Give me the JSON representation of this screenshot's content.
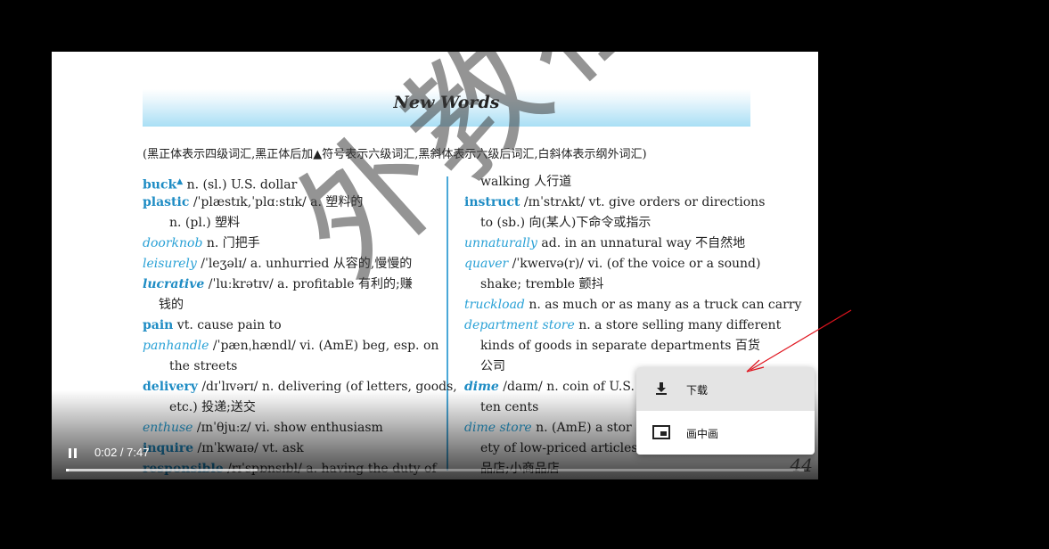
{
  "page": {
    "banner_title": "New Words",
    "note": "(黑正体表示四级词汇,黑正体后加▲符号表示六级词汇,黑斜体表示六级后词汇,白斜体表示纲外词汇)",
    "watermark": "外教社",
    "page_number": "44",
    "left_column": [
      {
        "hw": "buck",
        "mark": "▲",
        "style": "bold",
        "rest": " n. (sl.) U.S. dollar"
      },
      {
        "hw": "plastic",
        "style": "bold",
        "rest": " /ˈplæstɪk,ˈplɑːstɪk/ a. 塑料的"
      },
      {
        "hw": "",
        "style": "indent",
        "rest": "n. (pl.) 塑料"
      },
      {
        "hw": "doorknob",
        "style": "italic",
        "rest": " n. 门把手"
      },
      {
        "hw": "leisurely",
        "style": "italic",
        "rest": " /ˈleʒəlɪ/ a. unhurried  从容的,慢慢的"
      },
      {
        "hw": "lucrative",
        "style": "bolditalic",
        "rest": " /ˈluːkrətɪv/ a. profitable  有利的;赚"
      },
      {
        "hw": "",
        "style": "indent-small",
        "rest": "钱的"
      },
      {
        "hw": "pain",
        "style": "bold",
        "rest": " vt. cause pain to"
      },
      {
        "hw": "panhandle",
        "style": "italic",
        "rest": " /ˈpænˌhændl/ vi. (AmE) beg, esp. on"
      },
      {
        "hw": "",
        "style": "indent",
        "rest": "the streets"
      },
      {
        "hw": "delivery",
        "style": "bold",
        "rest": " /dɪˈlɪvərɪ/ n. delivering (of letters, goods,"
      },
      {
        "hw": "",
        "style": "indent",
        "rest": "etc.)  投递;送交"
      },
      {
        "hw": "enthuse",
        "style": "italic",
        "rest": " /ɪnˈθjuːz/ vi. show enthusiasm"
      },
      {
        "hw": "inquire",
        "style": "bold",
        "rest": " /ɪnˈkwaɪə/ vt. ask"
      },
      {
        "hw": "responsible",
        "style": "bold",
        "rest": " /rɪˈspɒnsɪbl/ a. having the duty of"
      }
    ],
    "right_column": [
      {
        "hw": "",
        "style": "indent-small",
        "rest": "walking  人行道"
      },
      {
        "hw": "instruct",
        "style": "bold",
        "rest": " /ɪnˈstrʌkt/ vt. give orders or directions"
      },
      {
        "hw": "",
        "style": "indent-small",
        "rest": "to (sb.)  向(某人)下命令或指示"
      },
      {
        "hw": "unnaturally",
        "style": "italic",
        "rest": " ad. in an unnatural way  不自然地"
      },
      {
        "hw": "quaver",
        "style": "italic",
        "rest": " /ˈkweɪvə(r)/ vi. (of the voice or a sound)"
      },
      {
        "hw": "",
        "style": "indent-small",
        "rest": "shake; tremble  颤抖"
      },
      {
        "hw": "truckload",
        "style": "italic",
        "rest": " n. as much or as many as a truck can carry"
      },
      {
        "hw": "department store",
        "style": "italic",
        "rest": " n. a store selling many different"
      },
      {
        "hw": "",
        "style": "indent-small",
        "rest": "kinds of goods in separate departments  百货"
      },
      {
        "hw": "",
        "style": "indent-small",
        "rest": "公司"
      },
      {
        "hw": "dime",
        "style": "bolditalic",
        "rest": " /daɪm/ n. coin of U.S."
      },
      {
        "hw": "",
        "style": "indent-small",
        "rest": "ten cents"
      },
      {
        "hw": "dime store",
        "style": "italic",
        "rest": " n. (AmE) a stor"
      },
      {
        "hw": "",
        "style": "indent-small",
        "rest": "ety of low-priced articles; va"
      },
      {
        "hw": "",
        "style": "indent-small",
        "rest": "品店;小商品店"
      }
    ]
  },
  "player": {
    "state": "playing",
    "time_display": "0:02 / 7:47",
    "progress_fraction": 0.004,
    "buffered_fraction": 0.26
  },
  "menu": {
    "items": [
      {
        "label": "下载",
        "icon": "download-icon",
        "selected": true
      },
      {
        "label": "画中画",
        "icon": "picture-in-picture-icon",
        "selected": false
      }
    ]
  },
  "colors": {
    "headword": "#1e8cc4",
    "annotation_arrow": "#e0141e"
  }
}
